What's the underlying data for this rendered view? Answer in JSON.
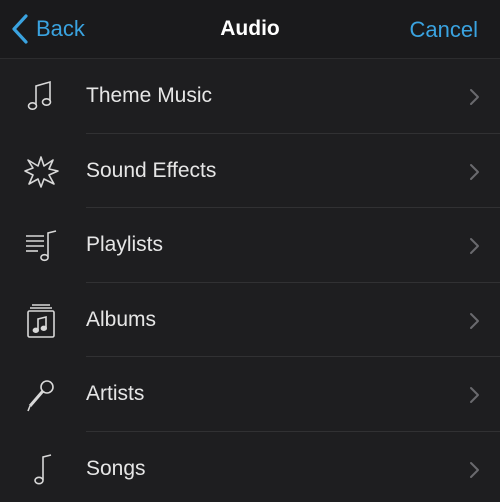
{
  "navbar": {
    "back_label": "Back",
    "title": "Audio",
    "cancel_label": "Cancel"
  },
  "colors": {
    "accent": "#3aa3e0",
    "background": "#1e1e20",
    "text": "#e6e6e6",
    "chevron": "#6a6a6e"
  },
  "items": [
    {
      "label": "Theme Music",
      "icon": "music-note-icon"
    },
    {
      "label": "Sound Effects",
      "icon": "burst-icon"
    },
    {
      "label": "Playlists",
      "icon": "playlist-icon"
    },
    {
      "label": "Albums",
      "icon": "album-icon"
    },
    {
      "label": "Artists",
      "icon": "microphone-icon"
    },
    {
      "label": "Songs",
      "icon": "song-note-icon"
    }
  ]
}
